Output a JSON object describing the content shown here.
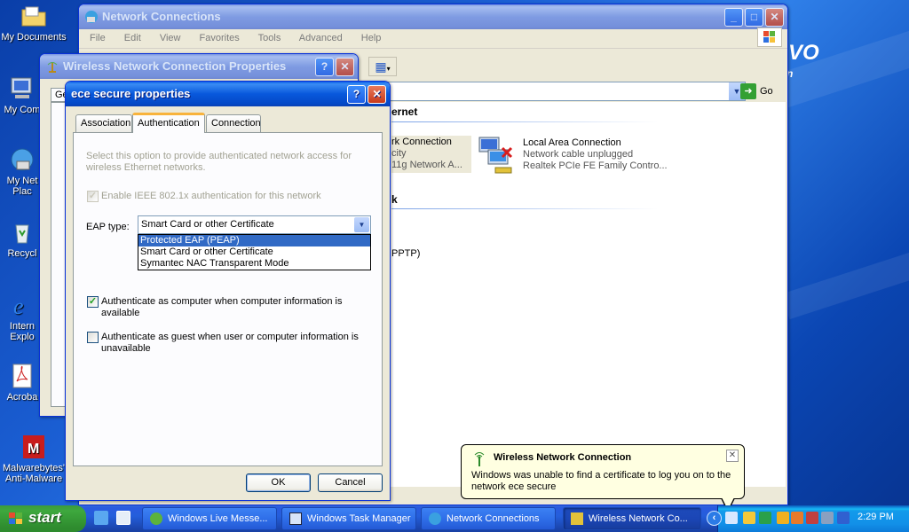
{
  "desktop": {
    "icons": [
      {
        "label": "My Documents"
      },
      {
        "label": "My Com"
      },
      {
        "label": "My Net Plac"
      },
      {
        "label": "Recycl"
      },
      {
        "label": "Intern Explo"
      },
      {
        "label": "Acroba"
      },
      {
        "label": "Malwarebytes' Anti-Malware"
      }
    ],
    "brand_partial": "VO",
    "brand_sub": "n"
  },
  "net_window": {
    "title": "Network Connections",
    "menu": [
      "File",
      "Edit",
      "View",
      "Favorites",
      "Tools",
      "Advanced",
      "Help"
    ],
    "go_label": "Go",
    "section_internet": "ernet",
    "section_k": "k",
    "item_wireless": {
      "line1": "rk Connection",
      "line2": "city",
      "line3": "11g Network A..."
    },
    "item_lan": {
      "name": "Local Area Connection",
      "status": "Network cable unplugged",
      "device": "Realtek PCIe FE Family Contro..."
    },
    "vpn_text": "PPTP)"
  },
  "wireless_props": {
    "title": "Wireless Network Connection Properties",
    "partial_label": "Ge"
  },
  "ece_dialog": {
    "title": "ece secure properties",
    "tabs": [
      "Association",
      "Authentication",
      "Connection"
    ],
    "active_tab": "Authentication",
    "desc": "Select this option to provide authenticated network access for wireless Ethernet networks.",
    "enable_8021x": "Enable IEEE 802.1x authentication for this network",
    "eap_label": "EAP type:",
    "eap_selected": "Smart Card or other Certificate",
    "eap_options": [
      "Protected EAP (PEAP)",
      "Smart Card or other Certificate",
      "Symantec NAC Transparent Mode"
    ],
    "auth_computer": "Authenticate as computer when computer information is available",
    "auth_guest": "Authenticate as guest when user or computer information is unavailable",
    "ok_label": "OK",
    "cancel_label": "Cancel"
  },
  "balloon": {
    "title": "Wireless Network Connection",
    "message": "Windows was unable to find a certificate to log you on to the network ece secure"
  },
  "taskbar": {
    "start_label": "start",
    "buttons": [
      {
        "label": "Windows Live Messe..."
      },
      {
        "label": "Windows Task Manager"
      },
      {
        "label": "Network Connections"
      },
      {
        "label": "Wireless Network Co..."
      }
    ],
    "clock": "2:29 PM"
  },
  "colors": {
    "xp_blue": "#0858dc",
    "selection": "#316ac5",
    "balloon_bg": "#ffffe1",
    "start_green": "#3ea83e"
  }
}
